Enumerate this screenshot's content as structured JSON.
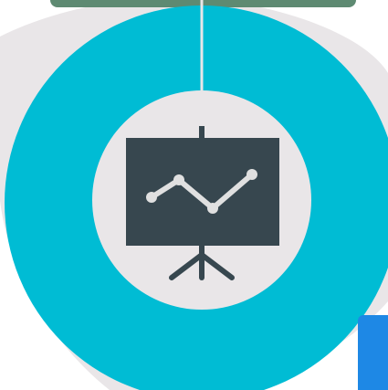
{
  "colors": {
    "background_blob": "#e9e6e8",
    "ring": "#00bcd4",
    "inner_disc": "#e9e6e8",
    "top_bar": "#5e8a72",
    "divider_line": "#e9e6e8",
    "board": "#37474f",
    "chart_line": "#e0e0e0",
    "blue_tab": "#1e88e5"
  },
  "icons": {
    "main_icon": "presentation-board-chart-icon",
    "ring": "progress-ring-icon"
  }
}
